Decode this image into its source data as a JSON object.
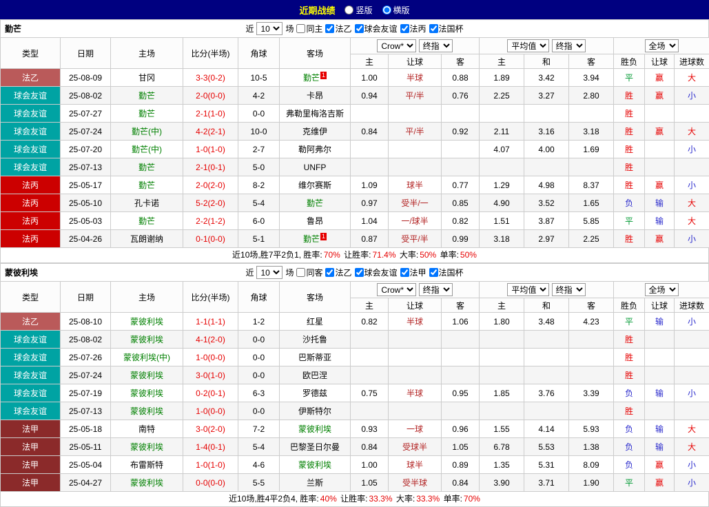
{
  "colors": {
    "topbar_bg": "#000080",
    "title_color": "#FFFF00",
    "leagues": {
      "fa2": "#BA5A5A",
      "friendly": "#00A3A3",
      "fa3": "#CC0000",
      "fa1": "#8B2A2A"
    },
    "focus_team": "#008000",
    "score": "#E60000",
    "handicap": "#B22222",
    "win": "#E60000",
    "draw": "#009933",
    "lose": "#2929CC"
  },
  "top_bar": {
    "title": "近期战绩",
    "vertical": "竖版",
    "horizontal": "横版"
  },
  "tables": [
    {
      "team": "勤芒",
      "filter": {
        "near": "近",
        "count": "10",
        "games": "场",
        "same": "同主",
        "leagues": [
          "法乙",
          "球会友谊",
          "法丙",
          "法国杯"
        ]
      },
      "header": {
        "cols": [
          "类型",
          "日期",
          "主场",
          "比分(半场)",
          "角球",
          "客场"
        ],
        "odds_company": "Crow*",
        "odds_type": "终指",
        "avg": "平均值",
        "avg_type": "终指",
        "full": "全场",
        "sub": [
          "主",
          "让球",
          "客",
          "主",
          "和",
          "客",
          "胜负",
          "让球",
          "进球数"
        ]
      },
      "rows": [
        {
          "league": "法乙",
          "lt": "fa2",
          "date": "25-08-09",
          "home": "甘冈",
          "score": "3-3(0-2)",
          "corner": "10-5",
          "away": "勤芒",
          "af": true,
          "ab": "1",
          "o_h": "1.00",
          "o_line": "半球",
          "o_a": "0.88",
          "avg_h": "1.89",
          "avg_d": "3.42",
          "avg_a": "3.94",
          "r1": "平",
          "r1t": "draw",
          "r2": "赢",
          "r2t": "win",
          "r3": "大",
          "r3t": "big"
        },
        {
          "league": "球会友谊",
          "lt": "friendly",
          "date": "25-08-02",
          "home": "勤芒",
          "hf": true,
          "score": "2-0(0-0)",
          "corner": "4-2",
          "away": "卡昂",
          "o_h": "0.94",
          "o_line": "平/半",
          "o_a": "0.76",
          "avg_h": "2.25",
          "avg_d": "3.27",
          "avg_a": "2.80",
          "r1": "胜",
          "r1t": "win",
          "r2": "赢",
          "r2t": "win",
          "r3": "小",
          "r3t": "small"
        },
        {
          "league": "球会友谊",
          "lt": "friendly",
          "date": "25-07-27",
          "home": "勤芒",
          "hf": true,
          "score": "2-1(1-0)",
          "corner": "0-0",
          "away": "弗勒里梅洛吉斯",
          "r1": "胜",
          "r1t": "win"
        },
        {
          "league": "球会友谊",
          "lt": "friendly",
          "date": "25-07-24",
          "home": "勤芒(中)",
          "hf": true,
          "score": "4-2(2-1)",
          "corner": "10-0",
          "away": "克维伊",
          "o_h": "0.84",
          "o_line": "平/半",
          "o_a": "0.92",
          "avg_h": "2.11",
          "avg_d": "3.16",
          "avg_a": "3.18",
          "r1": "胜",
          "r1t": "win",
          "r2": "赢",
          "r2t": "win",
          "r3": "大",
          "r3t": "big"
        },
        {
          "league": "球会友谊",
          "lt": "friendly",
          "date": "25-07-20",
          "home": "勤芒(中)",
          "hf": true,
          "score": "1-0(1-0)",
          "corner": "2-7",
          "away": "勒阿弗尔",
          "avg_h": "4.07",
          "avg_d": "4.00",
          "avg_a": "1.69",
          "r1": "胜",
          "r1t": "win",
          "r3": "小",
          "r3t": "small"
        },
        {
          "league": "球会友谊",
          "lt": "friendly",
          "date": "25-07-13",
          "home": "勤芒",
          "hf": true,
          "score": "2-1(0-1)",
          "corner": "5-0",
          "away": "UNFP",
          "r1": "胜",
          "r1t": "win"
        },
        {
          "league": "法丙",
          "lt": "fa3",
          "date": "25-05-17",
          "home": "勤芒",
          "hf": true,
          "score": "2-0(2-0)",
          "corner": "8-2",
          "away": "维尔赛斯",
          "o_h": "1.09",
          "o_line": "球半",
          "o_a": "0.77",
          "avg_h": "1.29",
          "avg_d": "4.98",
          "avg_a": "8.37",
          "r1": "胜",
          "r1t": "win",
          "r2": "赢",
          "r2t": "win",
          "r3": "小",
          "r3t": "small"
        },
        {
          "league": "法丙",
          "lt": "fa3",
          "date": "25-05-10",
          "home": "孔卡诺",
          "score": "5-2(2-0)",
          "corner": "5-4",
          "away": "勤芒",
          "af": true,
          "o_h": "0.97",
          "o_line": "受半/一",
          "o_a": "0.85",
          "avg_h": "4.90",
          "avg_d": "3.52",
          "avg_a": "1.65",
          "r1": "负",
          "r1t": "lose",
          "r2": "输",
          "r2t": "lose",
          "r3": "大",
          "r3t": "big"
        },
        {
          "league": "法丙",
          "lt": "fa3",
          "date": "25-05-03",
          "home": "勤芒",
          "hf": true,
          "score": "2-2(1-2)",
          "corner": "6-0",
          "away": "鲁昂",
          "o_h": "1.04",
          "o_line": "一/球半",
          "o_a": "0.82",
          "avg_h": "1.51",
          "avg_d": "3.87",
          "avg_a": "5.85",
          "r1": "平",
          "r1t": "draw",
          "r2": "输",
          "r2t": "lose",
          "r3": "大",
          "r3t": "big"
        },
        {
          "league": "法丙",
          "lt": "fa3",
          "date": "25-04-26",
          "home": "瓦朗谢纳",
          "score": "0-1(0-0)",
          "corner": "5-1",
          "away": "勤芒",
          "af": true,
          "ab": "1",
          "o_h": "0.87",
          "o_line": "受平/半",
          "o_a": "0.99",
          "avg_h": "3.18",
          "avg_d": "2.97",
          "avg_a": "2.25",
          "r1": "胜",
          "r1t": "win",
          "r2": "赢",
          "r2t": "win",
          "r3": "小",
          "r3t": "small"
        }
      ],
      "footer": {
        "prefix": "近10场,胜7平2负1, 胜率:",
        "win_rate": "70%",
        "l2": "让胜率:",
        "handicap_rate": "71.4%",
        "l3": "大率:",
        "big_rate": "50%",
        "l4": "单率:",
        "odd_rate": "50%"
      }
    },
    {
      "team": "蒙彼利埃",
      "filter": {
        "near": "近",
        "count": "10",
        "games": "场",
        "same": "同客",
        "leagues": [
          "法乙",
          "球会友谊",
          "法甲",
          "法国杯"
        ]
      },
      "header": {
        "cols": [
          "类型",
          "日期",
          "主场",
          "比分(半场)",
          "角球",
          "客场"
        ],
        "odds_company": "Crow*",
        "odds_type": "终指",
        "avg": "平均值",
        "avg_type": "终指",
        "full": "全场",
        "sub": [
          "主",
          "让球",
          "客",
          "主",
          "和",
          "客",
          "胜负",
          "让球",
          "进球数"
        ]
      },
      "rows": [
        {
          "league": "法乙",
          "lt": "fa2",
          "date": "25-08-10",
          "home": "蒙彼利埃",
          "hf": true,
          "score": "1-1(1-1)",
          "corner": "1-2",
          "away": "红星",
          "o_h": "0.82",
          "o_line": "半球",
          "o_a": "1.06",
          "avg_h": "1.80",
          "avg_d": "3.48",
          "avg_a": "4.23",
          "r1": "平",
          "r1t": "draw",
          "r2": "输",
          "r2t": "lose",
          "r3": "小",
          "r3t": "small"
        },
        {
          "league": "球会友谊",
          "lt": "friendly",
          "date": "25-08-02",
          "home": "蒙彼利埃",
          "hf": true,
          "score": "4-1(2-0)",
          "corner": "0-0",
          "away": "沙托鲁",
          "r1": "胜",
          "r1t": "win"
        },
        {
          "league": "球会友谊",
          "lt": "friendly",
          "date": "25-07-26",
          "home": "蒙彼利埃(中)",
          "hf": true,
          "score": "1-0(0-0)",
          "corner": "0-0",
          "away": "巴斯蒂亚",
          "r1": "胜",
          "r1t": "win"
        },
        {
          "league": "球会友谊",
          "lt": "friendly",
          "date": "25-07-24",
          "home": "蒙彼利埃",
          "hf": true,
          "score": "3-0(1-0)",
          "corner": "0-0",
          "away": "欧巴涅",
          "r1": "胜",
          "r1t": "win"
        },
        {
          "league": "球会友谊",
          "lt": "friendly",
          "date": "25-07-19",
          "home": "蒙彼利埃",
          "hf": true,
          "score": "0-2(0-1)",
          "corner": "6-3",
          "away": "罗德兹",
          "o_h": "0.75",
          "o_line": "半球",
          "o_a": "0.95",
          "avg_h": "1.85",
          "avg_d": "3.76",
          "avg_a": "3.39",
          "r1": "负",
          "r1t": "lose",
          "r2": "输",
          "r2t": "lose",
          "r3": "小",
          "r3t": "small"
        },
        {
          "league": "球会友谊",
          "lt": "friendly",
          "date": "25-07-13",
          "home": "蒙彼利埃",
          "hf": true,
          "score": "1-0(0-0)",
          "corner": "0-0",
          "away": "伊斯特尔",
          "r1": "胜",
          "r1t": "win"
        },
        {
          "league": "法甲",
          "lt": "fa1",
          "date": "25-05-18",
          "home": "南特",
          "score": "3-0(2-0)",
          "corner": "7-2",
          "away": "蒙彼利埃",
          "af": true,
          "o_h": "0.93",
          "o_line": "一球",
          "o_a": "0.96",
          "avg_h": "1.55",
          "avg_d": "4.14",
          "avg_a": "5.93",
          "r1": "负",
          "r1t": "lose",
          "r2": "输",
          "r2t": "lose",
          "r3": "大",
          "r3t": "big"
        },
        {
          "league": "法甲",
          "lt": "fa1",
          "date": "25-05-11",
          "home": "蒙彼利埃",
          "hf": true,
          "score": "1-4(0-1)",
          "corner": "5-4",
          "away": "巴黎圣日尔曼",
          "o_h": "0.84",
          "o_line": "受球半",
          "o_a": "1.05",
          "avg_h": "6.78",
          "avg_d": "5.53",
          "avg_a": "1.38",
          "r1": "负",
          "r1t": "lose",
          "r2": "输",
          "r2t": "lose",
          "r3": "大",
          "r3t": "big"
        },
        {
          "league": "法甲",
          "lt": "fa1",
          "date": "25-05-04",
          "home": "布雷斯特",
          "score": "1-0(1-0)",
          "corner": "4-6",
          "away": "蒙彼利埃",
          "af": true,
          "o_h": "1.00",
          "o_line": "球半",
          "o_a": "0.89",
          "avg_h": "1.35",
          "avg_d": "5.31",
          "avg_a": "8.09",
          "r1": "负",
          "r1t": "lose",
          "r2": "赢",
          "r2t": "win",
          "r3": "小",
          "r3t": "small"
        },
        {
          "league": "法甲",
          "lt": "fa1",
          "date": "25-04-27",
          "home": "蒙彼利埃",
          "hf": true,
          "score": "0-0(0-0)",
          "corner": "5-5",
          "away": "兰斯",
          "o_h": "1.05",
          "o_line": "受半球",
          "o_a": "0.84",
          "avg_h": "3.90",
          "avg_d": "3.71",
          "avg_a": "1.90",
          "r1": "平",
          "r1t": "draw",
          "r2": "赢",
          "r2t": "win",
          "r3": "小",
          "r3t": "small"
        }
      ],
      "footer": {
        "prefix": "近10场,胜4平2负4, 胜率:",
        "win_rate": "40%",
        "l2": "让胜率:",
        "handicap_rate": "33.3%",
        "l3": "大率:",
        "big_rate": "33.3%",
        "l4": "单率:",
        "odd_rate": "70%"
      }
    }
  ]
}
